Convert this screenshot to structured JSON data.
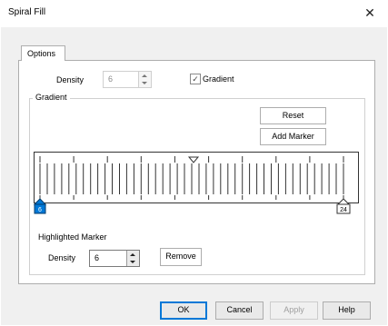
{
  "window": {
    "title": "Spiral Fill"
  },
  "tabs": [
    {
      "label": "Options"
    }
  ],
  "options": {
    "density_label": "Density",
    "density_value": "6",
    "gradient_checkbox_label": "Gradient",
    "gradient_checked": true
  },
  "gradient": {
    "group_label": "Gradient",
    "reset_label": "Reset",
    "add_marker_label": "Add Marker",
    "scale": {
      "min_value": 6,
      "max_value": 24,
      "markers": [
        {
          "label": "6",
          "selected": true
        },
        {
          "label": "24",
          "selected": false
        }
      ],
      "pointer_label": "current-position"
    },
    "highlighted_marker_label": "Highlighted Marker",
    "marker_density_label": "Density",
    "marker_density_value": "6",
    "remove_label": "Remove"
  },
  "footer": {
    "ok_label": "OK",
    "cancel_label": "Cancel",
    "apply_label": "Apply",
    "help_label": "Help"
  },
  "colors": {
    "accent": "#0078d7",
    "selected_marker": "#0078d7",
    "panel_bg": "#ffffff",
    "dialog_bg": "#f0f0f0"
  }
}
